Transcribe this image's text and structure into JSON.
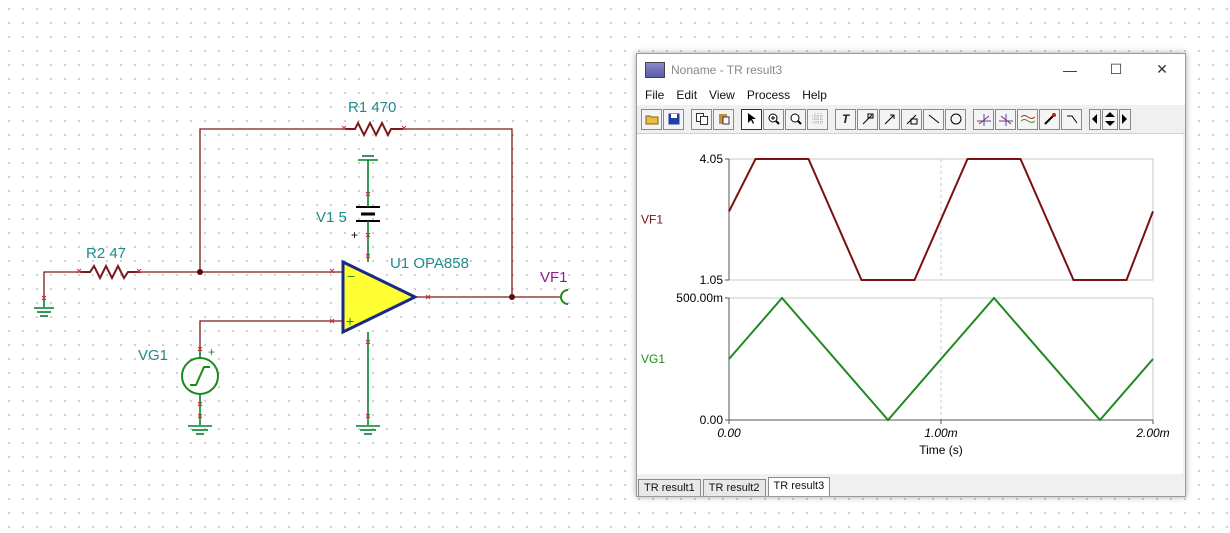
{
  "schematic": {
    "r1_label": "R1 470",
    "r2_label": "R2 47",
    "v1_label": "V1 5",
    "v1_plus": "+",
    "u1_label": "U1 OPA858",
    "vf1_label": "VF1",
    "vg1_label": "VG1",
    "vg1_plus": "+",
    "opamp_minus": "−",
    "opamp_plus": "+"
  },
  "window": {
    "title": "Noname - TR result3",
    "minimize": "—",
    "maximize": "☐",
    "close": "✕"
  },
  "menu": [
    "File",
    "Edit",
    "View",
    "Process",
    "Help"
  ],
  "toolbar": {
    "icons": [
      "open-icon",
      "save-icon",
      "copy-icon",
      "paste-icon",
      "pointer-icon",
      "zoom-in-icon",
      "zoom-100-icon",
      "grid-icon",
      "text-icon",
      "label-icon",
      "arrow-label-icon",
      "formula-label-icon",
      "line-icon",
      "circle-icon",
      "cursor-a-icon",
      "cursor-b-icon",
      "waveform-icon",
      "probe-icon",
      "step-icon",
      "left-arrow-icon",
      "up-down-icon",
      "right-arrow-icon"
    ],
    "text_glyph": "T"
  },
  "chart_data": {
    "type": "line",
    "xlabel": "Time (s)",
    "x_ticks": [
      "0.00",
      "1.00m",
      "2.00m"
    ],
    "xlim": [
      0,
      0.002
    ],
    "series": [
      {
        "name": "VF1",
        "color": "#7a1010",
        "y_ticks": [
          "4.05",
          "1.05"
        ],
        "ylim": [
          1.05,
          4.05
        ],
        "x": [
          0,
          0.000125,
          0.000375,
          0.000625,
          0.000875,
          0.001125,
          0.001375,
          0.001625,
          0.001875,
          0.002
        ],
        "y": [
          2.75,
          4.05,
          4.05,
          1.05,
          1.05,
          4.05,
          4.05,
          1.05,
          1.05,
          2.75
        ]
      },
      {
        "name": "VG1",
        "color": "#1f8a1f",
        "y_ticks": [
          "500.00m",
          "0.00"
        ],
        "ylim": [
          0,
          0.5
        ],
        "x": [
          0,
          0.00025,
          0.00075,
          0.00125,
          0.00175,
          0.002
        ],
        "y": [
          0.25,
          0.5,
          0,
          0.5,
          0,
          0.25
        ]
      }
    ]
  },
  "tabs": [
    "TR result1",
    "TR result2",
    "TR result3"
  ]
}
